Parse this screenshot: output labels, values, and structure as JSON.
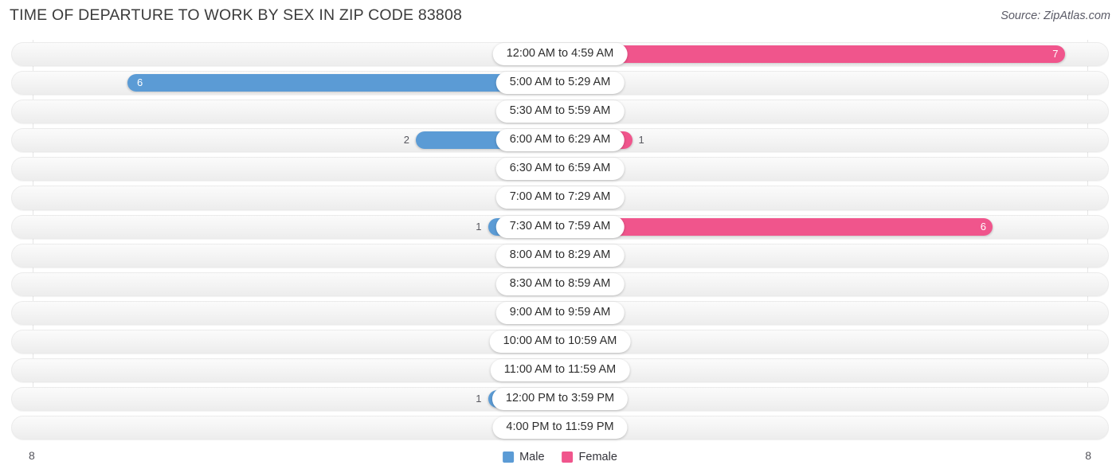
{
  "header": {
    "title": "TIME OF DEPARTURE TO WORK BY SEX IN ZIP CODE 83808",
    "source": "Source: ZipAtlas.com"
  },
  "legend": {
    "male_label": "Male",
    "female_label": "Female",
    "male_color": "#5b9bd5",
    "female_color": "#f0558c"
  },
  "axis": {
    "left_label": "8",
    "right_label": "8"
  },
  "colors": {
    "male_strong": "#5b9bd5",
    "male_light": "#a8c8e8",
    "female_strong": "#f0558c",
    "female_light": "#f7a8c4"
  },
  "chart_data": {
    "type": "bar",
    "orientation": "horizontal-diverging",
    "title": "TIME OF DEPARTURE TO WORK BY SEX IN ZIP CODE 83808",
    "xlabel": "",
    "ylabel": "",
    "xlim": [
      8,
      8
    ],
    "grid": true,
    "legend_position": "bottom-center",
    "categories": [
      "12:00 AM to 4:59 AM",
      "5:00 AM to 5:29 AM",
      "5:30 AM to 5:59 AM",
      "6:00 AM to 6:29 AM",
      "6:30 AM to 6:59 AM",
      "7:00 AM to 7:29 AM",
      "7:30 AM to 7:59 AM",
      "8:00 AM to 8:29 AM",
      "8:30 AM to 8:59 AM",
      "9:00 AM to 9:59 AM",
      "10:00 AM to 10:59 AM",
      "11:00 AM to 11:59 AM",
      "12:00 PM to 3:59 PM",
      "4:00 PM to 11:59 PM"
    ],
    "series": [
      {
        "name": "Male",
        "values": [
          0,
          6,
          0,
          2,
          0,
          0,
          1,
          0,
          0,
          0,
          0,
          0,
          1,
          0
        ]
      },
      {
        "name": "Female",
        "values": [
          7,
          0,
          0,
          1,
          0,
          0,
          6,
          0,
          0,
          0,
          0,
          0,
          0,
          0
        ]
      }
    ],
    "value_labels": {
      "male": [
        "0",
        "6",
        "0",
        "2",
        "0",
        "0",
        "1",
        "0",
        "0",
        "0",
        "0",
        "0",
        "1",
        "0"
      ],
      "female": [
        "7",
        "0",
        "0",
        "1",
        "0",
        "0",
        "6",
        "0",
        "0",
        "0",
        "0",
        "0",
        "0",
        "0"
      ]
    }
  }
}
